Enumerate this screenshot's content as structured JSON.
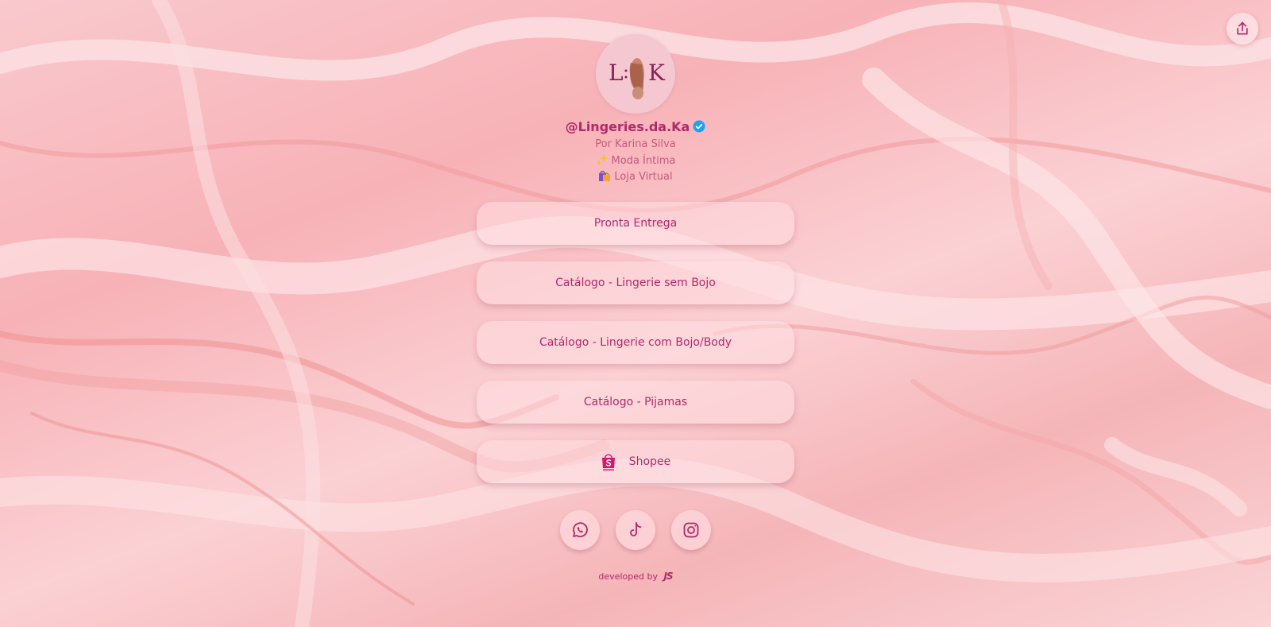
{
  "profile": {
    "handle": "@Lingeries.da.Ka",
    "bio": {
      "line1": "Por Karina Silva",
      "line2": "Moda Íntima",
      "line3": "Loja Virtual"
    },
    "logo_text_left": "L",
    "logo_text_right": "K"
  },
  "links": [
    {
      "label": "Pronta Entrega"
    },
    {
      "label": "Catálogo - Lingerie sem Bojo"
    },
    {
      "label": "Catálogo - Lingerie com Bojo/Body"
    },
    {
      "label": "Catálogo - Pijamas"
    },
    {
      "label": "Shopee",
      "icon": "shopee-bag-icon"
    }
  ],
  "socials": [
    {
      "name": "whatsapp",
      "icon": "whatsapp-icon"
    },
    {
      "name": "tiktok",
      "icon": "tiktok-icon"
    },
    {
      "name": "instagram",
      "icon": "instagram-icon"
    }
  ],
  "footer": {
    "text": "developed by",
    "brand": "JS"
  },
  "colors": {
    "accent": "#b0296b",
    "bio_text": "#c45a7e",
    "verified": "#1da1f2"
  }
}
